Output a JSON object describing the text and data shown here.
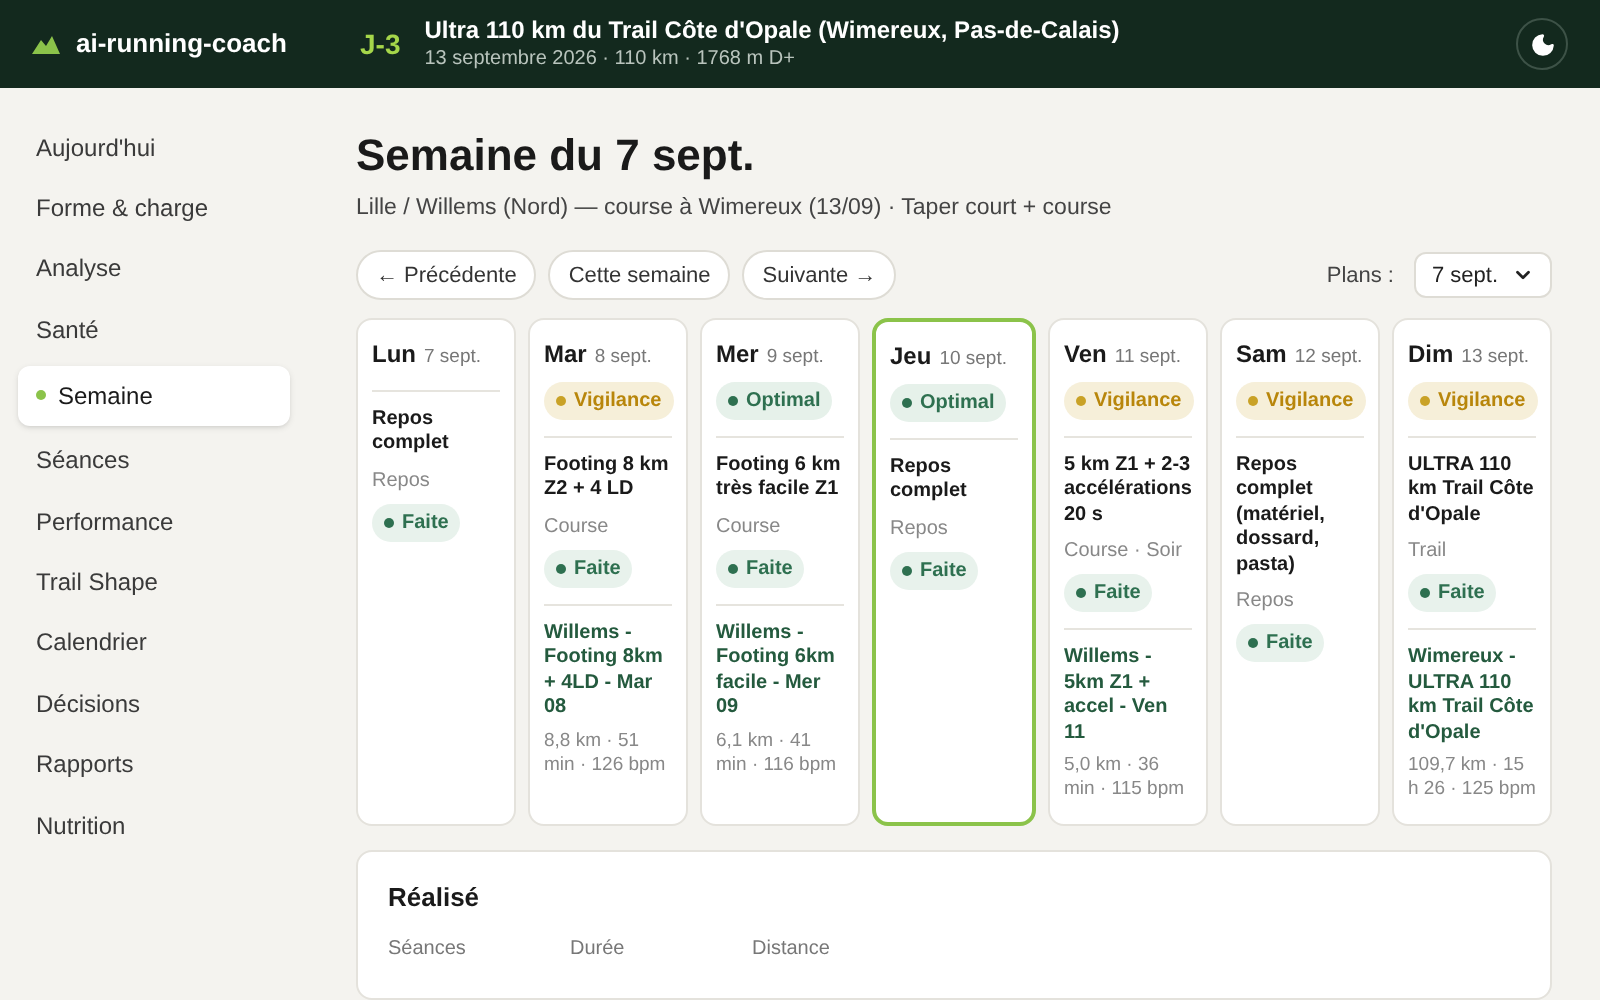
{
  "header": {
    "app_name": "ai-running-coach",
    "countdown": "J-3",
    "race_title": "Ultra 110 km du Trail Côte d'Opale (Wimereux, Pas-de-Calais)",
    "race_details": "13 septembre 2026 · 110 km · 1768 m D+"
  },
  "sidebar": {
    "items": [
      {
        "label": "Aujourd'hui",
        "selected": false
      },
      {
        "label": "Forme & charge",
        "selected": false
      },
      {
        "label": "Analyse",
        "selected": false
      },
      {
        "label": "Santé",
        "selected": false
      },
      {
        "label": "Semaine",
        "selected": true
      },
      {
        "label": "Séances",
        "selected": false
      },
      {
        "label": "Performance",
        "selected": false
      },
      {
        "label": "Trail Shape",
        "selected": false
      },
      {
        "label": "Calendrier",
        "selected": false
      },
      {
        "label": "Décisions",
        "selected": false
      },
      {
        "label": "Rapports",
        "selected": false
      },
      {
        "label": "Nutrition",
        "selected": false
      }
    ]
  },
  "page": {
    "title": "Semaine du 7 sept.",
    "subtitle": "Lille / Willems (Nord) — course à Wimereux (13/09) · Taper court + course"
  },
  "nav_buttons": [
    "← Précédente",
    "Cette semaine",
    "Suivante →"
  ],
  "plans": {
    "label": "Plans :",
    "value": "7 sept."
  },
  "days": [
    {
      "name": "Lun",
      "date": "7 sept.",
      "selected": false,
      "session": {
        "title": "Repos complet",
        "meta": "Repos",
        "status": "Faite"
      }
    },
    {
      "name": "Mar",
      "date": "8 sept.",
      "selected": false,
      "readiness": {
        "label": "Vigilance",
        "kind": "vigilance"
      },
      "session": {
        "title": "Footing 8 km Z2 + 4 LD",
        "meta": "Course",
        "status": "Faite"
      },
      "activity": {
        "title": "Willems - Footing 8km + 4LD - Mar 08",
        "stats": "8,8 km · 51 min · 126 bpm"
      }
    },
    {
      "name": "Mer",
      "date": "9 sept.",
      "selected": false,
      "readiness": {
        "label": "Optimal",
        "kind": "optimal"
      },
      "session": {
        "title": "Footing 6 km très facile Z1",
        "meta": "Course",
        "status": "Faite"
      },
      "activity": {
        "title": "Willems - Footing 6km facile - Mer 09",
        "stats": "6,1 km · 41 min · 116 bpm"
      }
    },
    {
      "name": "Jeu",
      "date": "10 sept.",
      "selected": true,
      "readiness": {
        "label": "Optimal",
        "kind": "optimal"
      },
      "session": {
        "title": "Repos complet",
        "meta": "Repos",
        "status": "Faite"
      }
    },
    {
      "name": "Ven",
      "date": "11 sept.",
      "selected": false,
      "readiness": {
        "label": "Vigilance",
        "kind": "vigilance"
      },
      "session": {
        "title": "5 km Z1 + 2-3 accélérations 20 s",
        "meta": "Course · Soir",
        "status": "Faite"
      },
      "activity": {
        "title": "Willems - 5km Z1 + accel - Ven 11",
        "stats": "5,0 km · 36 min · 115 bpm"
      }
    },
    {
      "name": "Sam",
      "date": "12 sept.",
      "selected": false,
      "readiness": {
        "label": "Vigilance",
        "kind": "vigilance"
      },
      "session": {
        "title": "Repos complet (matériel, dossard, pasta)",
        "meta": "Repos",
        "status": "Faite"
      }
    },
    {
      "name": "Dim",
      "date": "13 sept.",
      "selected": false,
      "readiness": {
        "label": "Vigilance",
        "kind": "vigilance"
      },
      "session": {
        "title": "ULTRA 110 km Trail Côte d'Opale",
        "meta": "Trail",
        "status": "Faite"
      },
      "activity": {
        "title": "Wimereux - ULTRA 110 km Trail Côte d'Opale",
        "stats": "109,7 km · 15 h 26 · 125 bpm"
      }
    }
  ],
  "summary": {
    "title": "Réalisé",
    "columns": [
      "Séances",
      "Durée",
      "Distance"
    ]
  }
}
